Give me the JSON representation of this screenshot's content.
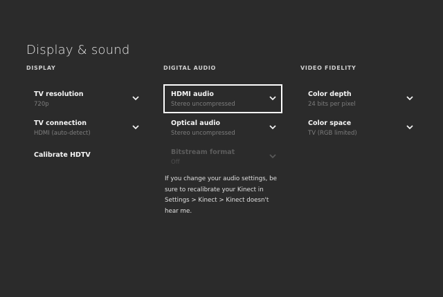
{
  "page": {
    "title": "Display & sound"
  },
  "display": {
    "header": "DISPLAY",
    "tv_resolution": {
      "label": "TV resolution",
      "value": "720p"
    },
    "tv_connection": {
      "label": "TV connection",
      "value": "HDMI (auto-detect)"
    },
    "calibrate": {
      "label": "Calibrate HDTV"
    }
  },
  "digital_audio": {
    "header": "DIGITAL AUDIO",
    "hdmi_audio": {
      "label": "HDMI audio",
      "value": "Stereo uncompressed"
    },
    "optical_audio": {
      "label": "Optical audio",
      "value": "Stereo uncompressed"
    },
    "bitstream_format": {
      "label": "Bitstream format",
      "value": "Off"
    },
    "note": "If you change your audio settings, be sure to recalibrate your Kinect in Settings > Kinect > Kinect doesn't hear me."
  },
  "video_fidelity": {
    "header": "VIDEO FIDELITY",
    "color_depth": {
      "label": "Color depth",
      "value": "24 bits per pixel"
    },
    "color_space": {
      "label": "Color space",
      "value": "TV (RGB limited)"
    }
  },
  "icons": {
    "dropdown": "chevron-down-icon"
  },
  "colors": {
    "background": "#2b2b2b",
    "focus_border": "#ffffff",
    "secondary_text": "#7e7e7e",
    "disabled_text": "#5c5c5c"
  }
}
